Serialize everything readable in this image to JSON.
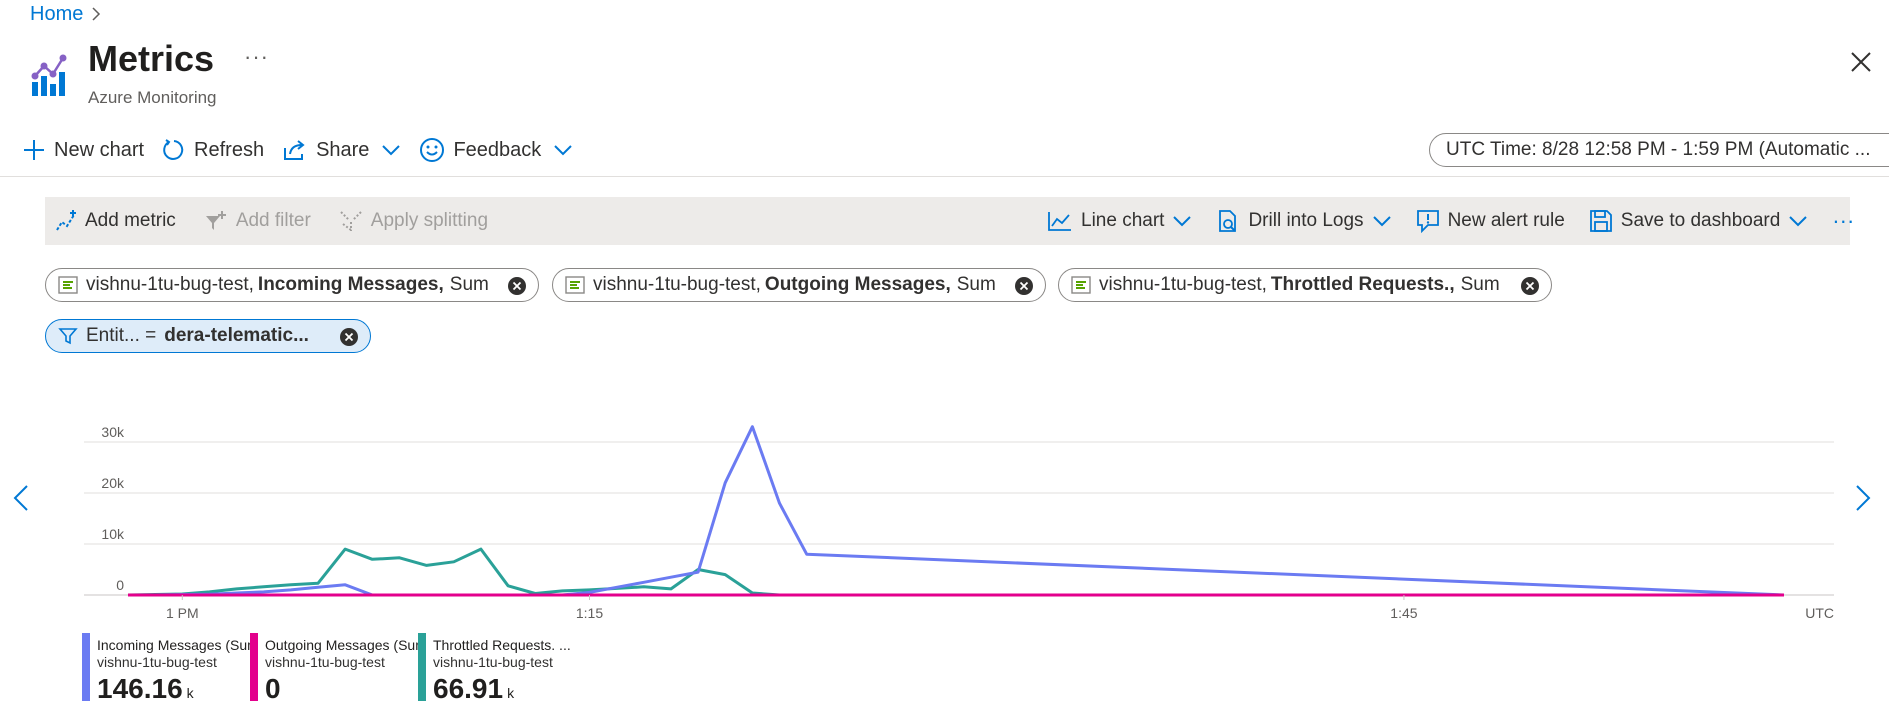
{
  "breadcrumb": {
    "home": "Home"
  },
  "header": {
    "title": "Metrics",
    "subtitle": "Azure Monitoring",
    "more": "···"
  },
  "commands": {
    "new_chart": "New chart",
    "refresh": "Refresh",
    "share": "Share",
    "feedback": "Feedback",
    "time_range": "UTC Time: 8/28 12:58 PM - 1:59 PM (Automatic ..."
  },
  "toolbar": {
    "add_metric": "Add metric",
    "add_filter": "Add filter",
    "apply_splitting": "Apply splitting",
    "line_chart": "Line chart",
    "drill_logs": "Drill into Logs",
    "new_alert": "New alert rule",
    "save_dashboard": "Save to dashboard",
    "more": "···"
  },
  "metric_pills": [
    {
      "resource": "vishnu-1tu-bug-test,",
      "metric": "Incoming Messages,",
      "agg": "Sum"
    },
    {
      "resource": "vishnu-1tu-bug-test,",
      "metric": "Outgoing Messages,",
      "agg": "Sum"
    },
    {
      "resource": "vishnu-1tu-bug-test,",
      "metric": "Throttled Requests.,",
      "agg": "Sum"
    }
  ],
  "filter_pill": {
    "key": "Entit... =",
    "value": "dera-telematic..."
  },
  "colors": {
    "incoming": "#6b7bf2",
    "outgoing": "#e3008c",
    "throttled": "#2aa198",
    "accent": "#0078d4"
  },
  "chart_data": {
    "type": "line",
    "yticks": [
      "30k",
      "20k",
      "10k",
      "0"
    ],
    "ytick_values": [
      30000,
      20000,
      10000,
      0
    ],
    "ylim": [
      0,
      30000
    ],
    "xticks": [
      "1 PM",
      "1:15",
      "1:45",
      "UTC"
    ],
    "xtick_minutes": [
      60,
      75,
      105
    ],
    "xlim_minutes": [
      58,
      119
    ],
    "x_minutes": [
      58,
      59,
      60,
      61,
      62,
      63,
      64,
      65,
      66,
      67,
      68,
      69,
      70,
      71,
      72,
      73,
      74,
      75,
      76,
      77,
      78,
      79,
      80,
      81,
      82,
      83,
      119
    ],
    "series": [
      {
        "name": "Incoming Messages (Sum)",
        "key": "incoming",
        "values": [
          0,
          0,
          100,
          150,
          400,
          600,
          1000,
          1500,
          2000,
          0,
          0,
          0,
          0,
          0,
          0,
          0,
          0,
          500,
          1500,
          2500,
          3500,
          4500,
          22000,
          33000,
          18000,
          8000,
          0
        ]
      },
      {
        "name": "Outgoing Messages (Sum)",
        "key": "outgoing",
        "values": [
          0,
          0,
          0,
          0,
          0,
          0,
          0,
          0,
          0,
          0,
          0,
          0,
          0,
          0,
          0,
          0,
          0,
          0,
          0,
          0,
          0,
          0,
          0,
          0,
          0,
          0,
          0
        ]
      },
      {
        "name": "Throttled Requests. ...",
        "key": "throttled",
        "values": [
          0,
          100,
          200,
          600,
          1200,
          1600,
          2000,
          2300,
          9000,
          7000,
          7300,
          5800,
          6500,
          9000,
          1800,
          300,
          800,
          1000,
          1300,
          1600,
          1200,
          5000,
          4000,
          400,
          0,
          0,
          0
        ]
      }
    ]
  },
  "legend": [
    {
      "label": "Incoming Messages (Sum)",
      "resource": "vishnu-1tu-bug-test",
      "value": "146.16",
      "unit": "k"
    },
    {
      "label": "Outgoing Messages (Sum)",
      "resource": "vishnu-1tu-bug-test",
      "value": "0",
      "unit": ""
    },
    {
      "label": "Throttled Requests. ...",
      "resource": "vishnu-1tu-bug-test",
      "value": "66.91",
      "unit": "k"
    }
  ]
}
